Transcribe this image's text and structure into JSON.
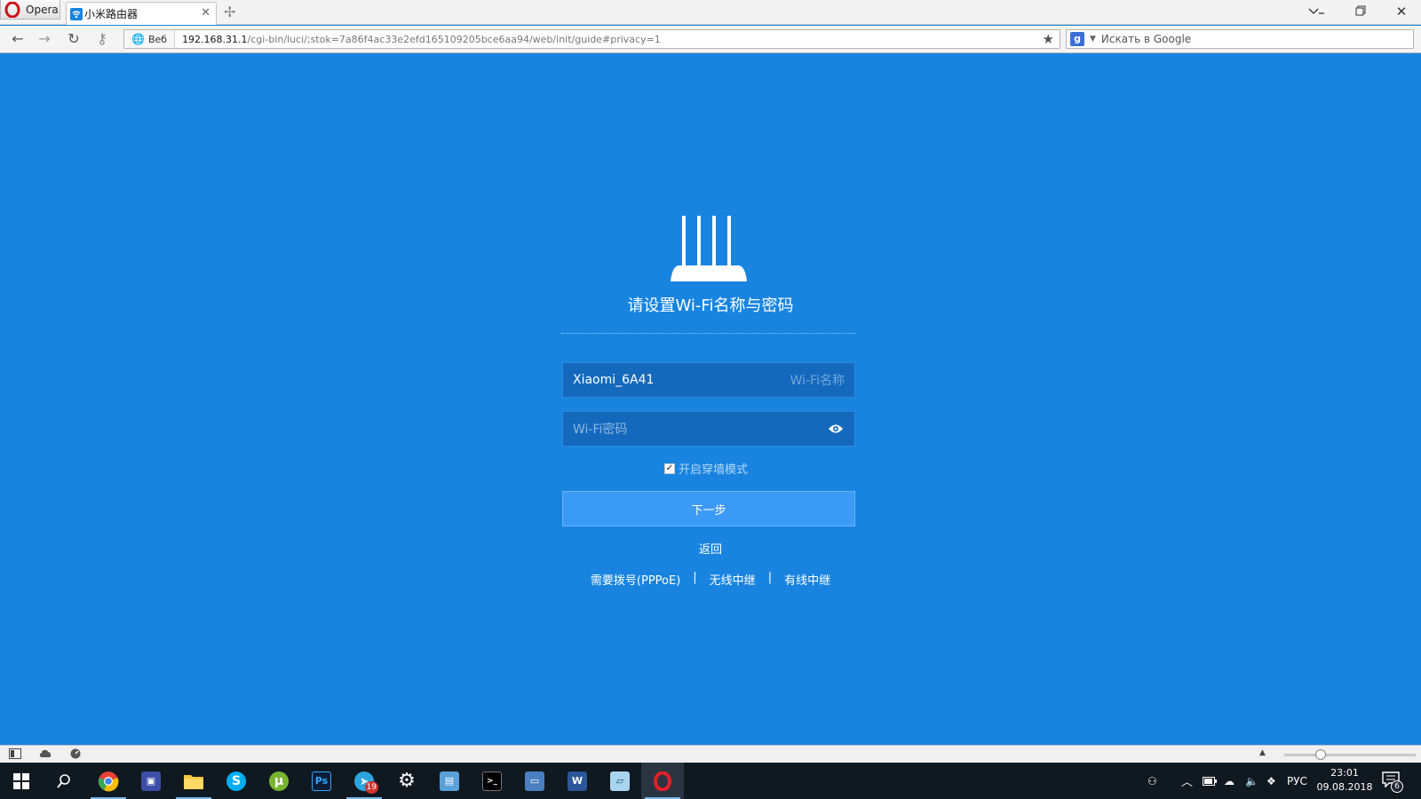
{
  "browser": {
    "menu_label": "Opera",
    "tab_title": "小米路由器",
    "site_badge": "Веб",
    "url_host": "192.168.31.1",
    "url_rest": "/cgi-bin/luci/;stok=7a86f4ac33e2efd165109205bce6aa94/web/init/guide#privacy=1",
    "search_placeholder": "Искать в Google"
  },
  "page": {
    "title": "请设置Wi-Fi名称与密码",
    "wifi_name_value": "Xiaomi_6A41",
    "wifi_name_hint": "Wi-Fi名称",
    "wifi_password_placeholder": "Wi-Fi密码",
    "wall_mode_label": "开启穿墙模式",
    "wall_mode_checked": true,
    "next_label": "下一步",
    "back_label": "返回",
    "alt_links": {
      "pppoe": "需要拨号(PPPoE)",
      "wireless_relay": "无线中继",
      "wired_relay": "有线中继",
      "separator": "|"
    }
  },
  "taskbar": {
    "telegram_badge": "19",
    "language": "РУС",
    "time": "23:01",
    "date": "09.08.2018",
    "notifications": "6"
  },
  "colors": {
    "page_bg": "#1884e0",
    "field_bg": "#1569bd",
    "button_bg": "#3c9af7",
    "taskbar_bg": "#101820"
  }
}
